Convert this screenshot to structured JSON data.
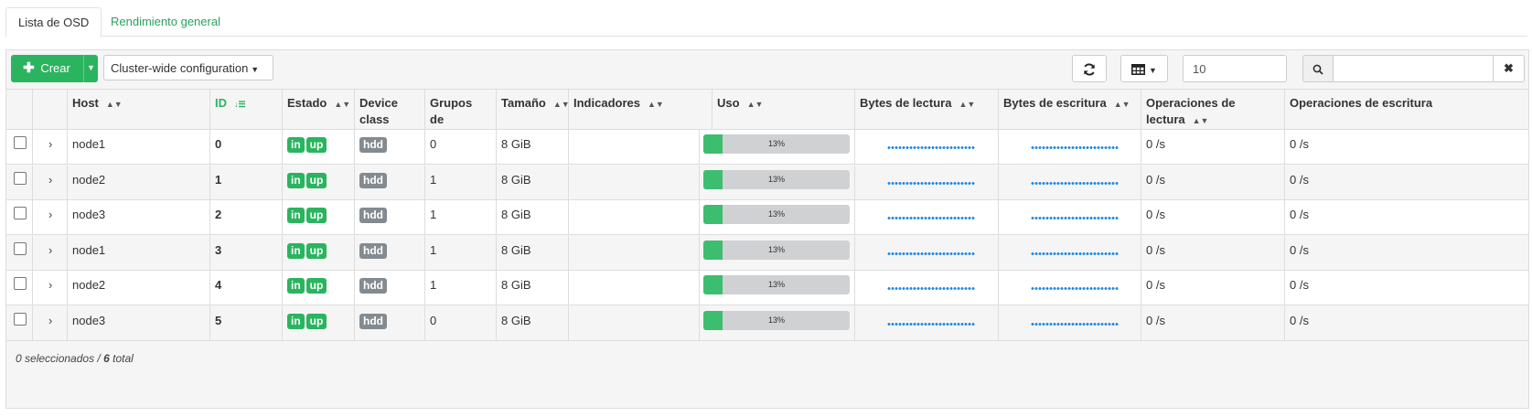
{
  "tabs": [
    {
      "label": "Lista de OSD",
      "active": true
    },
    {
      "label": "Rendimiento general",
      "active": false
    }
  ],
  "toolbar": {
    "create_label": "Crear",
    "cluster_config_label": "Cluster-wide configuration",
    "page_size_value": "10",
    "search_value": ""
  },
  "columns": [
    {
      "label": ""
    },
    {
      "label": ""
    },
    {
      "label": "Host"
    },
    {
      "label": "ID",
      "sorted": "ascending"
    },
    {
      "label": "Estado"
    },
    {
      "label": "Device class"
    },
    {
      "label": "Grupos de colocación"
    },
    {
      "label": "Tamaño"
    },
    {
      "label": "Indicadores"
    },
    {
      "label": "Uso"
    },
    {
      "label": "Bytes de lectura"
    },
    {
      "label": "Bytes de escritura"
    },
    {
      "label": "Operaciones de lectura"
    },
    {
      "label": "Operaciones de escritura"
    }
  ],
  "rows": [
    {
      "host": "node1",
      "id": "0",
      "state_in": "in",
      "state_up": "up",
      "device_class": "hdd",
      "pgs": "0",
      "size": "8 GiB",
      "flags": "",
      "usage_label": "13%",
      "usage_fraction": 0.13,
      "read_ops": "0 /s",
      "write_ops": "0 /s"
    },
    {
      "host": "node2",
      "id": "1",
      "state_in": "in",
      "state_up": "up",
      "device_class": "hdd",
      "pgs": "1",
      "size": "8 GiB",
      "flags": "",
      "usage_label": "13%",
      "usage_fraction": 0.13,
      "read_ops": "0 /s",
      "write_ops": "0 /s"
    },
    {
      "host": "node3",
      "id": "2",
      "state_in": "in",
      "state_up": "up",
      "device_class": "hdd",
      "pgs": "1",
      "size": "8 GiB",
      "flags": "",
      "usage_label": "13%",
      "usage_fraction": 0.13,
      "read_ops": "0 /s",
      "write_ops": "0 /s"
    },
    {
      "host": "node1",
      "id": "3",
      "state_in": "in",
      "state_up": "up",
      "device_class": "hdd",
      "pgs": "1",
      "size": "8 GiB",
      "flags": "",
      "usage_label": "13%",
      "usage_fraction": 0.13,
      "read_ops": "0 /s",
      "write_ops": "0 /s"
    },
    {
      "host": "node2",
      "id": "4",
      "state_in": "in",
      "state_up": "up",
      "device_class": "hdd",
      "pgs": "1",
      "size": "8 GiB",
      "flags": "",
      "usage_label": "13%",
      "usage_fraction": 0.13,
      "read_ops": "0 /s",
      "write_ops": "0 /s"
    },
    {
      "host": "node3",
      "id": "5",
      "state_in": "in",
      "state_up": "up",
      "device_class": "hdd",
      "pgs": "0",
      "size": "8 GiB",
      "flags": "",
      "usage_label": "13%",
      "usage_fraction": 0.13,
      "read_ops": "0 /s",
      "write_ops": "0 /s"
    }
  ],
  "footer": {
    "selected_count": "0",
    "selected_label": "seleccionados /",
    "total_count": "6",
    "total_label": "total"
  },
  "icons": {
    "create": "plus-icon",
    "refresh": "refresh-icon",
    "columns": "table-columns-icon",
    "search": "search-icon",
    "clear": "close-icon"
  },
  "colors": {
    "accent_green": "#2bb45f",
    "badge_grey": "#838b91",
    "usage_fill": "#3dbd6f",
    "sparkline_blue": "#1e88e5"
  }
}
